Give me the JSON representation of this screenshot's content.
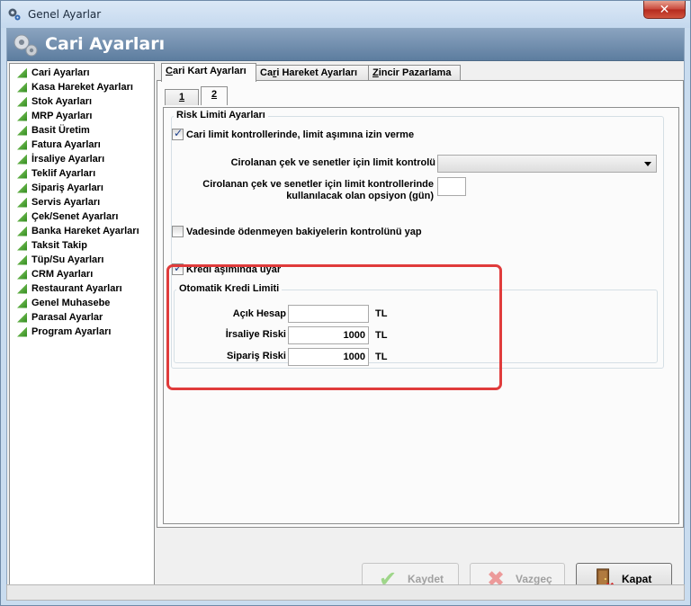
{
  "window": {
    "title": "Genel Ayarlar",
    "close_glyph": "✕"
  },
  "header": {
    "title": "Cari Ayarları"
  },
  "sidebar": {
    "items": [
      "Cari Ayarları",
      "Kasa Hareket Ayarları",
      "Stok Ayarları",
      "MRP Ayarları",
      "Basit Üretim",
      "Fatura Ayarları",
      "İrsaliye Ayarları",
      "Teklif Ayarları",
      "Sipariş Ayarları",
      "Servis Ayarları",
      "Çek/Senet Ayarları",
      "Banka Hareket Ayarları",
      "Taksit Takip",
      "Tüp/Su Ayarları",
      "CRM Ayarları",
      "Restaurant Ayarları",
      "Genel Muhasebe",
      "Parasal Ayarlar",
      "Program Ayarları"
    ]
  },
  "tabs": {
    "t1": {
      "u": "C",
      "rest": "ari Kart Ayarları"
    },
    "t2": {
      "pre": "Ca",
      "u": "r",
      "rest": "i Hareket Ayarları"
    },
    "t3": {
      "u": "Z",
      "rest": "incir Pazarlama"
    },
    "active": "t1"
  },
  "subtabs": {
    "s1": "1",
    "s2": "2",
    "active": "s2"
  },
  "risk": {
    "group_title": "Risk Limiti Ayarları",
    "cari_limit_label": "Cari limit kontrollerinde, limit aşımına izin verme",
    "cari_limit_checked": true,
    "cirolanan_label": "Cirolanan çek ve senetler için limit kontrolü",
    "cirolanan_value": "",
    "opsiyon_label_1": "Cirolanan çek ve senetler için limit kontrollerinde",
    "opsiyon_label_2": "kullanılacak olan opsiyon (gün)",
    "opsiyon_value": "",
    "vade_label": "Vadesinde ödenmeyen bakiyelerin kontrolünü yap",
    "vade_checked": false,
    "kredi_label": "Kredi aşımında uyar",
    "kredi_checked": true
  },
  "kredi": {
    "group_title": "Otomatik Kredi Limiti",
    "acik_label": "Açık Hesap",
    "acik_value": "",
    "irsaliye_label": "İrsaliye Riski",
    "irsaliye_value": "1000",
    "siparis_label": "Sipariş Riski",
    "siparis_value": "1000",
    "currency": "TL"
  },
  "buttons": {
    "save": "Kaydet",
    "cancel": "Vazgeç",
    "close": "Kapat"
  },
  "colors": {
    "highlight": "#e03b3b",
    "header": "#6e8cad",
    "check": "#1b3f8a"
  }
}
